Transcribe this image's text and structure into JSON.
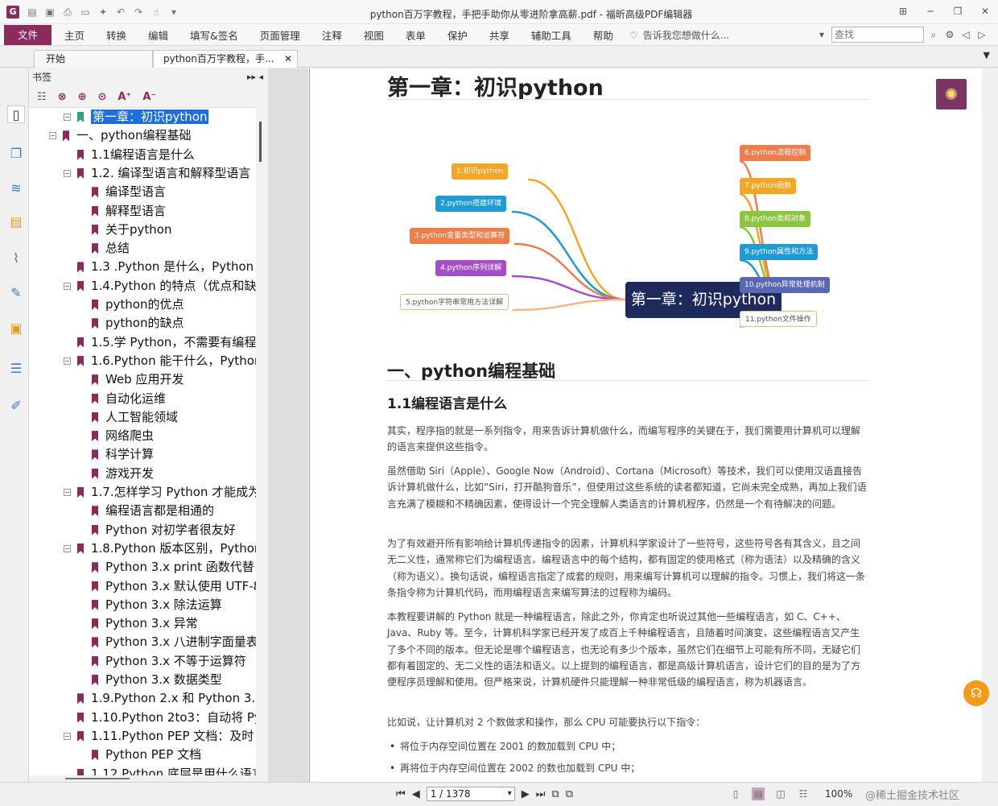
{
  "window": {
    "title": "python百万字教程，手把手助你从零进阶拿高薪.pdf - 福昕高级PDF编辑器",
    "app_icon": "G"
  },
  "menu": {
    "file": "文件",
    "items": [
      "主页",
      "转换",
      "编辑",
      "填写&签名",
      "页面管理",
      "注释",
      "视图",
      "表单",
      "保护",
      "共享",
      "辅助工具",
      "帮助"
    ],
    "tell_me": "告诉我您想做什么...",
    "search_placeholder": "查找"
  },
  "tabs": [
    {
      "label": "开始"
    },
    {
      "label": "python百万字教程，手..."
    }
  ],
  "bookmarks": {
    "header": "书签",
    "items": [
      {
        "label": "第一章：初识python"
      },
      {
        "label": "一、python编程基础"
      },
      {
        "label": "1.1编程语言是什么"
      },
      {
        "label": "1.2. 编译型语言和解释型语言"
      },
      {
        "label": "编译型语言"
      },
      {
        "label": "解释型语言"
      },
      {
        "label": "关于python"
      },
      {
        "label": "总结"
      },
      {
        "label": "1.3 .Python 是什么，Python"
      },
      {
        "label": "1.4.Python 的特点（优点和缺"
      },
      {
        "label": "python的优点"
      },
      {
        "label": "python的缺点"
      },
      {
        "label": "1.5.学 Python，不需要有编程"
      },
      {
        "label": "1.6.Python 能干什么，Python"
      },
      {
        "label": "Web 应用开发"
      },
      {
        "label": "自动化运维"
      },
      {
        "label": "人工智能领域"
      },
      {
        "label": "网络爬虫"
      },
      {
        "label": "科学计算"
      },
      {
        "label": "游戏开发"
      },
      {
        "label": "1.7.怎样学习 Python 才能成为"
      },
      {
        "label": "编程语言都是相通的"
      },
      {
        "label": "Python 对初学者很友好"
      },
      {
        "label": "1.8.Python 版本区别，Python"
      },
      {
        "label": "Python 3.x print 函数代替"
      },
      {
        "label": "Python 3.x 默认使用 UTF-8"
      },
      {
        "label": "Python 3.x 除法运算"
      },
      {
        "label": "Python 3.x 异常"
      },
      {
        "label": "Python 3.x 八进制字面量表"
      },
      {
        "label": "Python 3.x 不等于运算符"
      },
      {
        "label": "Python 3.x 数据类型"
      },
      {
        "label": "1.9.Python 2.x 和 Python 3.x"
      },
      {
        "label": "1.10.Python 2to3：自动将 Py"
      },
      {
        "label": "1.11.Python PEP 文档：及时"
      },
      {
        "label": "Python PEP 文档"
      },
      {
        "label": "1.12.Python 底层是用什么语言"
      }
    ]
  },
  "document": {
    "chapter_title": "第一章：初识python",
    "mindmap": {
      "center": "第一章：初识python",
      "left": [
        {
          "label": "1.初识python",
          "color": "#f5a623"
        },
        {
          "label": "2.python搭建环境",
          "color": "#1e9bd7"
        },
        {
          "label": "3.python变量类型和运算符",
          "color": "#f07c4a"
        },
        {
          "label": "4.python序列详解",
          "color": "#a44fc7"
        },
        {
          "label": "5.python字符串常用方法详解",
          "color": "#ffffff"
        }
      ],
      "right": [
        {
          "label": "6.python流程控制",
          "color": "#f07c4a"
        },
        {
          "label": "7.python函数",
          "color": "#f5a623"
        },
        {
          "label": "8.python类和对象",
          "color": "#8cc63f"
        },
        {
          "label": "9.python属性和方法",
          "color": "#1e9bd7"
        },
        {
          "label": "10.python异常处理机制",
          "color": "#5a67b5"
        },
        {
          "label": "11.python文件操作",
          "color": "#ffffff"
        }
      ]
    },
    "section_title": "一、python编程基础",
    "subsection_title": "1.1编程语言是什么",
    "paragraphs": [
      "其实，程序指的就是一系列指令，用来告诉计算机做什么，而编写程序的关键在于，我们需要用计算机可以理解的语言来提供这些指令。",
      "虽然借助 Siri（Apple）、Google Now（Android）、Cortana（Microsoft）等技术，我们可以使用汉语直接告诉计算机做什么，比如“Siri，打开酷狗音乐”，但使用过这些系统的读者都知道，它尚未完全成熟，再加上我们语言充满了模糊和不精确因素，使得设计一个完全理解人类语言的计算机程序，仍然是一个有待解决的问题。",
      "为了有效避开所有影响给计算机传递指令的因素，计算机科学家设计了一些符号，这些符号各有其含义，且之间无二义性，通常称它们为编程语言。编程语言中的每个结构，都有固定的使用格式（称为语法）以及精确的含义（称为语义）。换句话说，编程语言指定了成套的规则，用来编写计算机可以理解的指令。习惯上，我们将这一条条指令称为计算机代码，而用编程语言来编写算法的过程称为编码。",
      "本教程要讲解的 Python 就是一种编程语言，除此之外，你肯定也听说过其他一些编程语言，如 C、C++、Java、Ruby 等。至今，计算机科学家已经开发了成百上千种编程语言，且随着时间演变，这些编程语言又产生了多个不同的版本。但无论是哪个编程语言，也无论有多少个版本，虽然它们在细节上可能有所不同，无疑它们都有着固定的、无二义性的语法和语义。以上提到的编程语言，都是高级计算机语言，设计它们的目的是为了方便程序员理解和使用。但严格来说，计算机硬件只能理解一种非常低级的编程语言，称为机器语言。",
      "比如说，让计算机对 2 个数做求和操作，那么 CPU 可能要执行以下指令："
    ],
    "bullets": [
      "将位于内存空间位置在 2001 的数加载到 CPU 中；",
      "再将位于内存空间位置在 2002 的数也加载到 CPU 中；"
    ]
  },
  "status": {
    "page_field": "1 / 1378",
    "zoom": "100%",
    "watermark": "@稀土掘金技术社区"
  },
  "accent_color": "#8a2a5d"
}
